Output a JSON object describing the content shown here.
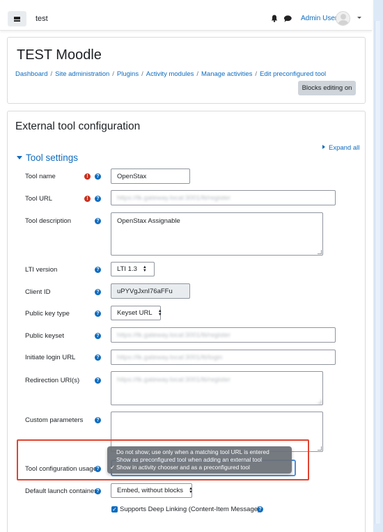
{
  "navbar": {
    "site_name": "test",
    "user_name": "Admin User"
  },
  "header": {
    "title": "TEST Moodle",
    "breadcrumb": [
      "Dashboard",
      "Site administration",
      "Plugins",
      "Activity modules",
      "Manage activities",
      "Edit preconfigured tool"
    ],
    "blocks_editing_button": "Blocks editing on"
  },
  "form": {
    "heading": "External tool configuration",
    "expand_all": "Expand all",
    "section": "Tool settings",
    "fields": {
      "tool_name": {
        "label": "Tool name",
        "value": "OpenStax"
      },
      "tool_url": {
        "label": "Tool URL",
        "value": "https://tk.gateway.local:3001/lti/register"
      },
      "tool_description": {
        "label": "Tool description",
        "value": "OpenStax Assignable"
      },
      "lti_version": {
        "label": "LTI version",
        "value": "LTI 1.3"
      },
      "client_id": {
        "label": "Client ID",
        "value": "uPYVgJxnI76aFFu"
      },
      "public_key_type": {
        "label": "Public key type",
        "value": "Keyset URL"
      },
      "public_keyset": {
        "label": "Public keyset",
        "value": "https://tk.gateway.local:3001/lti/register"
      },
      "initiate_login_url": {
        "label": "Initiate login URL",
        "value": "https://tk.gateway.local:3001/lti/login"
      },
      "redirection_uris": {
        "label": "Redirection URI(s)",
        "value": "https://tk.gateway.local:3001/lti/register"
      },
      "custom_parameters": {
        "label": "Custom parameters",
        "value": ""
      },
      "tool_configuration_usage": {
        "label": "Tool configuration usage",
        "options": [
          "Do not show; use only when a matching tool URL is entered",
          "Show as preconfigured tool when adding an external tool",
          "Show in activity chooser and as a preconfigured tool"
        ],
        "selected_check": "✓"
      },
      "default_launch_container": {
        "label": "Default launch container",
        "value": "Embed, without blocks"
      },
      "deep_linking": {
        "label": "Supports Deep Linking (Content-Item Message)"
      }
    }
  },
  "colors": {
    "link": "#0f6cbf",
    "required": "#ca3120",
    "highlight": "#e2432f"
  }
}
